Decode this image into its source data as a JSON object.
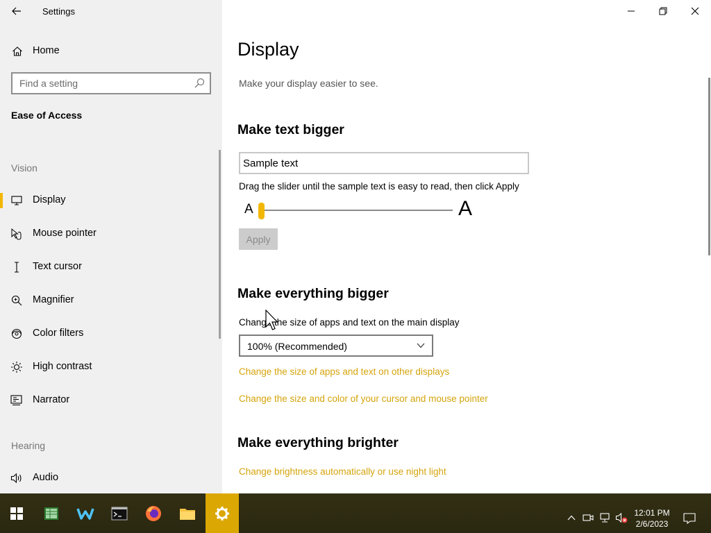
{
  "window": {
    "title": "Settings"
  },
  "sidebar": {
    "home_label": "Home",
    "search_placeholder": "Find a setting",
    "section_title": "Ease of Access",
    "groups": {
      "vision": "Vision",
      "hearing": "Hearing"
    },
    "items": [
      {
        "label": "Display",
        "icon": "monitor-icon",
        "selected": true
      },
      {
        "label": "Mouse pointer",
        "icon": "mouse-pointer-icon"
      },
      {
        "label": "Text cursor",
        "icon": "text-cursor-icon"
      },
      {
        "label": "Magnifier",
        "icon": "magnifier-icon"
      },
      {
        "label": "Color filters",
        "icon": "color-filters-icon"
      },
      {
        "label": "High contrast",
        "icon": "high-contrast-icon"
      },
      {
        "label": "Narrator",
        "icon": "narrator-icon"
      }
    ],
    "hearing_items": [
      {
        "label": "Audio",
        "icon": "audio-icon"
      }
    ]
  },
  "main": {
    "title": "Display",
    "subtitle": "Make your display easier to see.",
    "text_bigger": {
      "heading": "Make text bigger",
      "sample_text": "Sample text",
      "instructions": "Drag the slider until the sample text is easy to read, then click Apply",
      "slider_min_label": "A",
      "slider_max_label": "A",
      "slider_value_fraction": 0.0,
      "apply_label": "Apply"
    },
    "everything_bigger": {
      "heading": "Make everything bigger",
      "description": "Change the size of apps and text on the main display",
      "scale_selected": "100% (Recommended)",
      "link_other_displays": "Change the size of apps and text on other displays",
      "link_cursor": "Change the size and color of your cursor and mouse pointer"
    },
    "everything_brighter": {
      "heading": "Make everything brighter",
      "link_brightness": "Change brightness automatically or use night light"
    }
  },
  "taskbar": {
    "apps": [
      "start-icon",
      "spreadsheet-app-icon",
      "wps-app-icon",
      "terminal-icon",
      "firefox-icon",
      "file-explorer-icon",
      "settings-icon"
    ],
    "active_app": "settings-icon",
    "time": "12:01 PM",
    "date": "2/6/2023"
  },
  "colors": {
    "accent": "#f2b705",
    "link": "#d5a40c",
    "taskbar_bg": "#2e2c12",
    "sidebar_bg": "#f0f0f0"
  }
}
